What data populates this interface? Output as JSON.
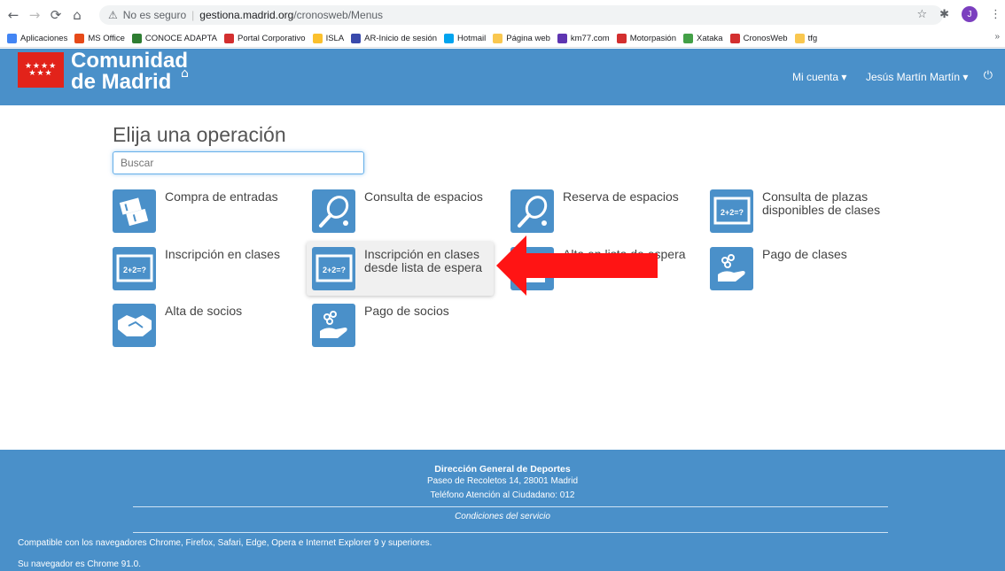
{
  "browser": {
    "insecure_label": "No es seguro",
    "url_host": "gestiona.madrid.org",
    "url_path": "/cronosweb/Menus",
    "profile_initial": "J",
    "bookmarks": [
      {
        "label": "Aplicaciones",
        "color": "#4285f4"
      },
      {
        "label": "MS Office",
        "color": "#e64a19"
      },
      {
        "label": "CONOCE ADAPTA",
        "color": "#2e7d32"
      },
      {
        "label": "Portal Corporativo",
        "color": "#d32f2f"
      },
      {
        "label": "ISLA",
        "color": "#fbc02d"
      },
      {
        "label": "AR-Inicio de sesión",
        "color": "#3949ab"
      },
      {
        "label": "Hotmail",
        "color": "#00a4ef"
      },
      {
        "label": "Página web",
        "color": "#f9c74f"
      },
      {
        "label": "km77.com",
        "color": "#5e35b1"
      },
      {
        "label": "Motorpasión",
        "color": "#d32f2f"
      },
      {
        "label": "Xataka",
        "color": "#43a047"
      },
      {
        "label": "CronosWeb",
        "color": "#d32f2f"
      },
      {
        "label": "tfg",
        "color": "#f9c74f"
      }
    ]
  },
  "header": {
    "brand_line1": "Comunidad",
    "brand_line2": "de Madrid",
    "flag_stars": "★★★★\n★★★",
    "account_menu": "Mi cuenta ▾",
    "user_menu": "Jesús Martín Martín ▾",
    "brand_color": "#4a90c9",
    "flag_color": "#e2231a"
  },
  "main": {
    "title": "Elija una operación",
    "search_placeholder": "Buscar",
    "operations": [
      {
        "label": "Compra de entradas",
        "icon": "tickets-icon"
      },
      {
        "label": "Consulta de espacios",
        "icon": "tennis-racket-icon"
      },
      {
        "label": "Reserva de espacios",
        "icon": "tennis-racket-icon"
      },
      {
        "label": "Consulta de plazas disponibles de clases",
        "icon": "blackboard-icon"
      },
      {
        "label": "Inscripción en clases",
        "icon": "blackboard-icon"
      },
      {
        "label": "Inscripción en clases desde lista de espera",
        "icon": "blackboard-icon"
      },
      {
        "label": "Alta en lista de espera",
        "icon": "waitlist-icon"
      },
      {
        "label": "Pago de clases",
        "icon": "hand-coins-icon"
      },
      {
        "label": "Alta de socios",
        "icon": "handshake-icon"
      },
      {
        "label": "Pago de socios",
        "icon": "hand-coins-icon"
      }
    ],
    "blackboard_text": "2+2=?"
  },
  "footer": {
    "org": "Dirección General de Deportes",
    "address": "Paseo de Recoletos 14, 28001 Madrid",
    "phone": "Teléfono Atención al Ciudadano: 012",
    "terms": "Condiciones del servicio",
    "compat": "Compatible con los navegadores Chrome, Firefox, Safari, Edge, Opera e Internet Explorer 9 y superiores.",
    "browser_info": "Su navegador es Chrome 91.0."
  }
}
